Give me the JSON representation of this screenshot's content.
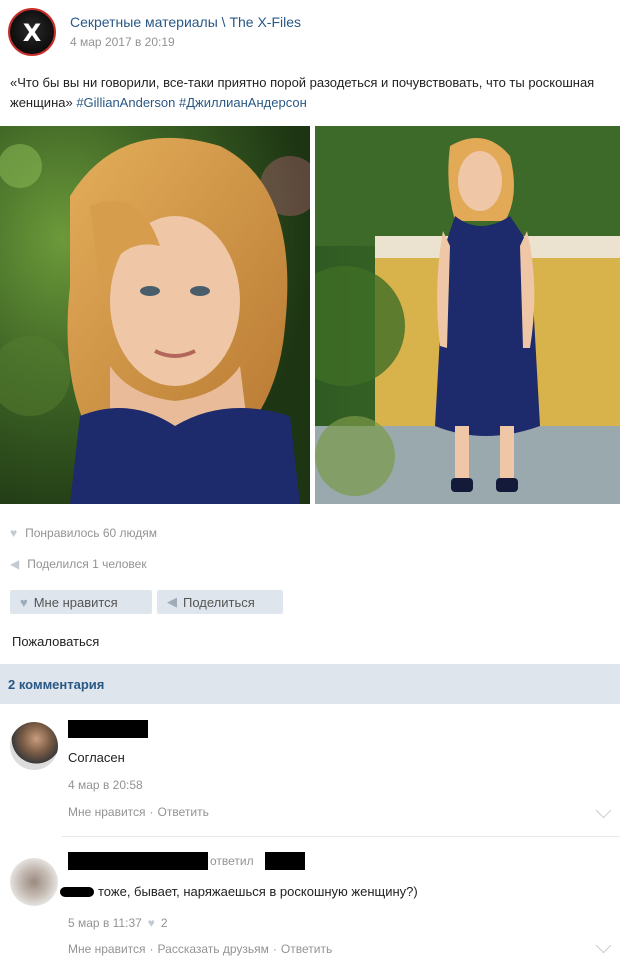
{
  "post": {
    "group_name": "Секретные материалы \\ The X-Files",
    "avatar_letter": "X",
    "date": "4 мар 2017 в 20:19",
    "text": "«Что бы вы ни говорили, все-таки приятно порой разодеться и почувствовать, что ты роскошная женщина»",
    "hashtag_1": "#GillianAnderson",
    "hashtag_2": "#ДжиллианАндерсон"
  },
  "stats": {
    "likes_text": "Понравилось 60 людям",
    "shares_text": "Поделился 1 человек"
  },
  "actions": {
    "like_label": "Мне нравится",
    "share_label": "Поделиться",
    "report_label": "Пожаловаться"
  },
  "comments_header": "2 комментария",
  "comments": [
    {
      "text": "Согласен",
      "date": "4 мар в 20:58",
      "like": "Мне нравится",
      "reply": "Ответить"
    },
    {
      "answered": "ответил",
      "text": "тоже, бывает, наряжаешься в роскошную женщину?)",
      "date": "5 мар в 11:37",
      "likes": "2",
      "like": "Мне нравится",
      "tell_friends": "Рассказать друзьям",
      "reply": "Ответить"
    }
  ],
  "colors": {
    "link": "#2a5885",
    "muted": "#939393",
    "header_bg": "#dfe5ec",
    "accent": "#c9302c"
  },
  "icons": [
    "x-files-logo",
    "heart-icon",
    "megaphone-icon",
    "chevron-down-icon"
  ]
}
